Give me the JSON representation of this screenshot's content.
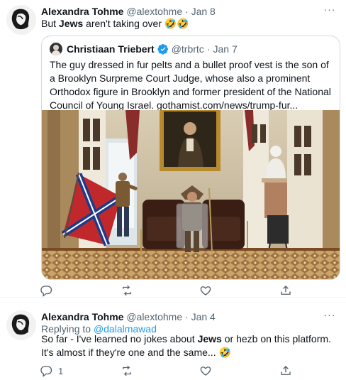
{
  "tweets": [
    {
      "author_name": "Alexandra Tohme",
      "handle": "@alextohme",
      "separator": "·",
      "date": "Jan 8",
      "more_icon": "more-icon",
      "text_before": "But ",
      "text_bold": "Jews",
      "text_after": " aren't taking over 🤣🤣",
      "quote": {
        "author_name": "Christiaan Triebert",
        "handle": "@trbrtc",
        "separator": "·",
        "date": "Jan 7",
        "verified_icon": "verified-badge-icon",
        "text": "The guy dressed in fur pelts and a bullet proof vest is the son of a Brooklyn Surpreme Court Judge, whose also a prominent Orthodox figure in Brooklyn and former president of the National Council of Young Israel. gothamist.com/news/trump-fur...",
        "image_description_icon": "photo-image"
      },
      "actions": {
        "replies": "",
        "retweets": "",
        "likes": ""
      }
    },
    {
      "author_name": "Alexandra Tohme",
      "handle": "@alextohme",
      "separator": "·",
      "date": "Jan 4",
      "more_icon": "more-icon",
      "replying_label": "Replying to ",
      "replying_handle": "@dalalmawad",
      "text_before": "So far - I've learned no jokes about ",
      "text_bold": "Jews",
      "text_after": " or hezb on this platform. It's almost if they're one and the same... 🤣",
      "actions": {
        "replies": "1",
        "retweets": "",
        "likes": ""
      }
    }
  ],
  "colors": {
    "accent": "#1d9bf0",
    "muted": "#536471",
    "text": "#0f1419",
    "border": "#cfd9de"
  }
}
